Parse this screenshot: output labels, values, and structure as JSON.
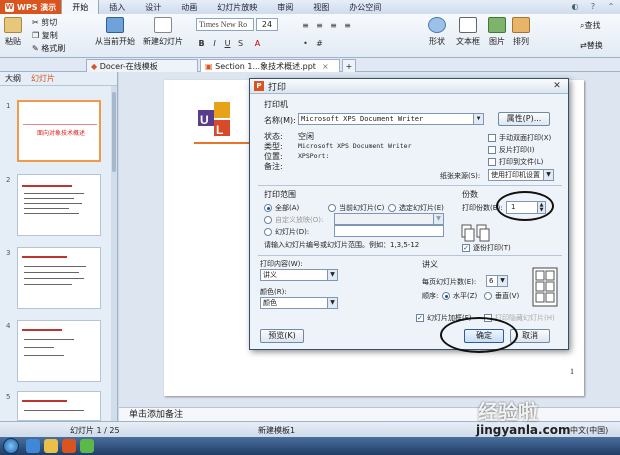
{
  "app": {
    "name": "WPS 演示"
  },
  "ribbon": {
    "tabs": [
      "开始",
      "插入",
      "设计",
      "动画",
      "幻灯片放映",
      "审阅",
      "视图",
      "办公空间"
    ]
  },
  "toolbar": {
    "paste": "粘贴",
    "cut": "剪切",
    "copy": "复制",
    "format_painter": "格式刷",
    "from_current": "从当前开始",
    "new_slide": "新建幻灯片",
    "font": "Times New Ro",
    "size": "24",
    "shape": "形状",
    "textbox": "文本框",
    "picture": "图片",
    "arrange": "排列",
    "find": "查找",
    "replace": "替换"
  },
  "doc_tabs": [
    "Docer-在线模板",
    "Section 1...象技术概述.ppt"
  ],
  "left_panel": {
    "tabs": [
      "大纲",
      "幻灯片"
    ],
    "thumb_numbers": [
      "1",
      "2",
      "3",
      "4",
      "5"
    ],
    "thumb1_title": "面向对象技术概述"
  },
  "slide": {
    "page_number": "1"
  },
  "notes_placeholder": "单击添加备注",
  "status": {
    "slide_info": "幻灯片 1 / 25",
    "theme": "新建模板1",
    "mode": "中文(中国)"
  },
  "print_dialog": {
    "title": "打印",
    "printer_group": "打印机",
    "name_label": "名称(M):",
    "printer_name": "Microsoft XPS Document Writer",
    "properties_button": "属性(P)...",
    "status_label": "状态:",
    "status_value": "空闲",
    "type_label": "类型:",
    "type_value": "Microsoft XPS Document Writer",
    "location_label": "位置:",
    "location_value": "XPSPort:",
    "comment_label": "备注:",
    "manual_duplex": "手动双面打印(X)",
    "reverse_print": "反片打印(I)",
    "print_to_file": "打印到文件(L)",
    "paper_source_label": "纸张来源(S):",
    "paper_source_value": "使用打印机设置",
    "range_group": "打印范围",
    "range_all": "全部(A)",
    "range_current": "当前幻灯片(C)",
    "range_selection": "选定幻灯片(E)",
    "range_custom": "自定义放映(O):",
    "range_slides": "幻灯片(D):",
    "range_hint": "请输入幻灯片编号或幻灯片范围。例如：1,3,5-12",
    "copies_group": "份数",
    "copies_label": "打印份数(B):",
    "copies_value": "1",
    "collate": "逐份打印(T)",
    "print_what_label": "打印内容(W):",
    "print_what_value": "讲义",
    "color_label": "颜色(R):",
    "color_value": "颜色",
    "handouts_group": "讲义",
    "per_page_label": "每页幻灯片数(E):",
    "per_page_value": "6",
    "order_label": "顺序:",
    "order_horizontal": "水平(Z)",
    "order_vertical": "垂直(V)",
    "frame_slides": "幻灯片加框(F)",
    "print_hidden": "打印隐藏幻灯片(H)",
    "preview_button": "预览(K)",
    "ok_button": "确定",
    "cancel_button": "取消"
  },
  "watermark": {
    "text": "经验啦",
    "url": "jingyanla.com"
  }
}
